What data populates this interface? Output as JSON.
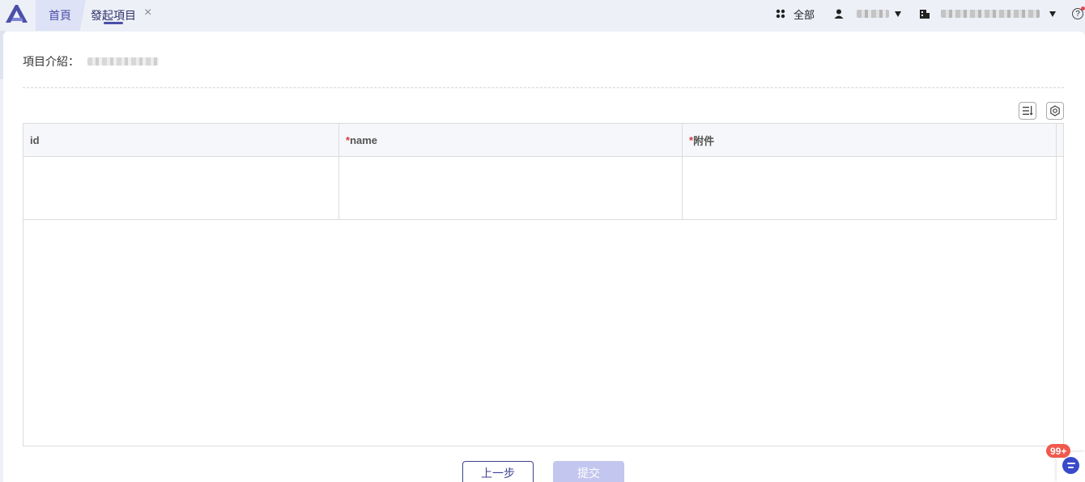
{
  "header": {
    "logo_icon": "app-logo-icon",
    "tabs": [
      {
        "label": "首頁",
        "active": false
      },
      {
        "label": "發起項目",
        "active": true,
        "close_label": "×"
      }
    ],
    "tools": {
      "all_label": "全部",
      "help_label": "?"
    }
  },
  "project": {
    "intro_label": "項目介紹："
  },
  "table": {
    "columns": [
      {
        "label": "id",
        "required": false
      },
      {
        "label": "name",
        "required": true
      },
      {
        "label": "附件",
        "required": true
      }
    ],
    "required_mark": "*",
    "rows": [
      {
        "id": "",
        "name": "",
        "attachment": ""
      }
    ]
  },
  "actions": {
    "prev_label": "上一步",
    "submit_label": "提交"
  },
  "notification": {
    "badge": "99+"
  },
  "colors": {
    "accent": "#3e4290",
    "submit_disabled": "#c3c6ee",
    "badge": "#ef5a4d",
    "chat": "#3949c9"
  }
}
